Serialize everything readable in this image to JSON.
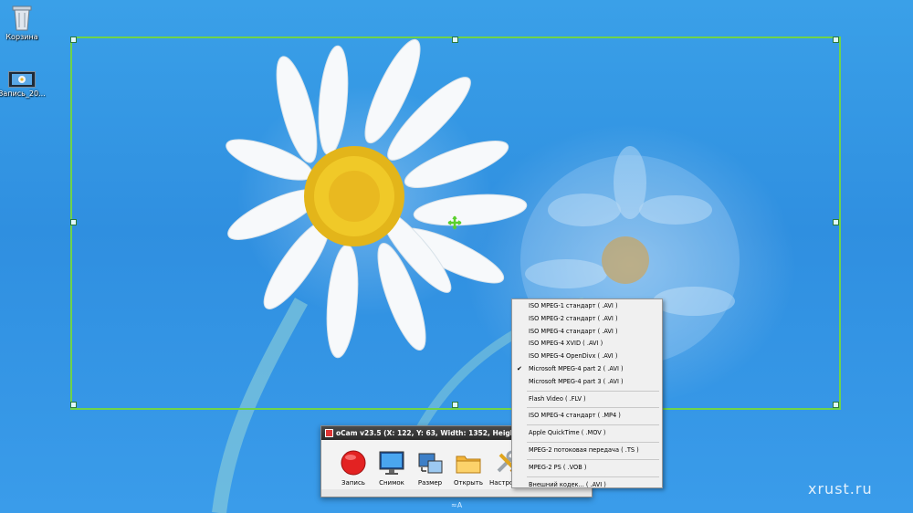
{
  "desktop": {
    "icons": [
      {
        "label": "Корзина",
        "icon": "recycle-bin-icon"
      },
      {
        "label": "Запись_20...",
        "icon": "video-file-icon"
      }
    ]
  },
  "capture": {
    "crosshair_icon": "move-crosshair-icon",
    "frame_color": "#6fd34a"
  },
  "ocam": {
    "title": "oCam v23.5 (X: 122, Y: 63, Width: 1352, Height: 658)",
    "tools": [
      {
        "label": "Запись",
        "icon": "record-icon"
      },
      {
        "label": "Снимок",
        "icon": "screenshot-monitor-icon"
      },
      {
        "label": "Размер",
        "icon": "resize-icon"
      },
      {
        "label": "Открыть",
        "icon": "folder-icon"
      },
      {
        "label": "Настройки",
        "icon": "settings-tools-icon"
      }
    ]
  },
  "codec_menu": {
    "items": [
      {
        "label": "ISO MPEG-1 стандарт ( .AVI )",
        "checked": false
      },
      {
        "label": "ISO MPEG-2 стандарт ( .AVI )",
        "checked": false
      },
      {
        "label": "ISO MPEG-4 стандарт ( .AVI )",
        "checked": false
      },
      {
        "label": "ISO MPEG-4 XVID ( .AVI )",
        "checked": false
      },
      {
        "label": "ISO MPEG-4 OpenDivx ( .AVI )",
        "checked": false
      },
      {
        "label": "Microsoft MPEG-4 part 2 ( .AVI )",
        "checked": true
      },
      {
        "label": "Microsoft MPEG-4 part 3 ( .AVI )",
        "checked": false
      },
      {
        "label": "Flash Video ( .FLV )",
        "checked": false
      },
      {
        "label": "ISO MPEG-4 стандарт ( .MP4 )",
        "checked": false
      },
      {
        "label": "Apple QuickTime ( .MOV )",
        "checked": false
      },
      {
        "label": "MPEG-2 потоковая передача ( .TS )",
        "checked": false
      },
      {
        "label": "MPEG-2 PS ( .VOB )",
        "checked": false
      },
      {
        "label": "Внешний кодек... ( .AVI )",
        "checked": false
      }
    ],
    "check_mark": "✔"
  },
  "watermark": "xrust.ru",
  "taskbar_hint": "≈A"
}
